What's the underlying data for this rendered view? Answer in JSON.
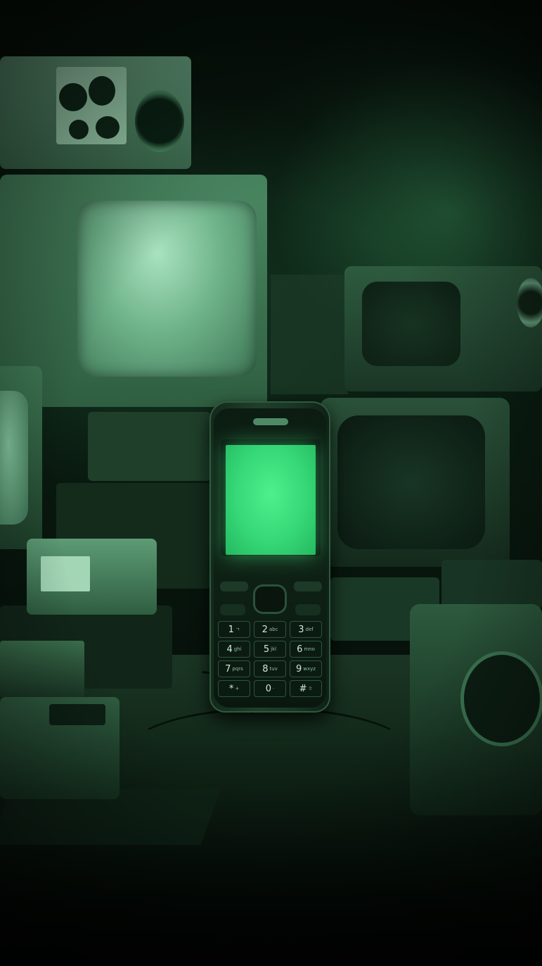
{
  "scene": {
    "accent_color": "#3ee57e",
    "phone": {
      "keys": [
        {
          "main": "1",
          "sub": "ㄱ"
        },
        {
          "main": "2",
          "sub": "abc"
        },
        {
          "main": "3",
          "sub": "def"
        },
        {
          "main": "4",
          "sub": "ghi"
        },
        {
          "main": "5",
          "sub": "jkl"
        },
        {
          "main": "6",
          "sub": "mno"
        },
        {
          "main": "7",
          "sub": "pqrs"
        },
        {
          "main": "8",
          "sub": "tuv"
        },
        {
          "main": "9",
          "sub": "wxyz"
        },
        {
          "main": "*",
          "sub": "+"
        },
        {
          "main": "0",
          "sub": "·"
        },
        {
          "main": "#",
          "sub": "⇧"
        }
      ]
    }
  }
}
